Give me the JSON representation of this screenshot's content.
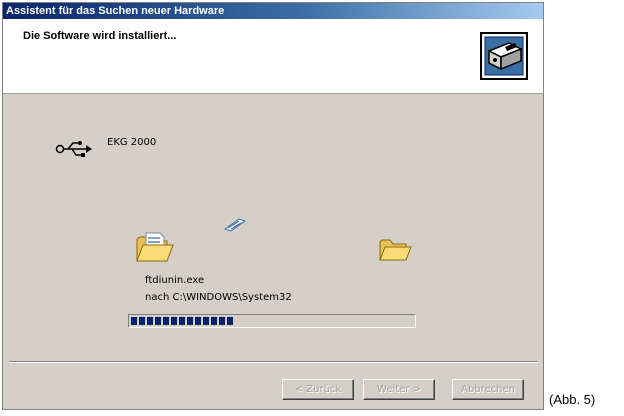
{
  "window": {
    "title": "Assistent für das Suchen neuer Hardware"
  },
  "header": {
    "title": "Die Software wird installiert...",
    "icon": "hardware-wizard-icon"
  },
  "device": {
    "icon": "usb-icon",
    "name": "EKG 2000"
  },
  "copy_animation": {
    "source_icon": "folder-open-icon",
    "flying_icon": "flying-document-icon",
    "target_icon": "folder-open-icon"
  },
  "file": {
    "name": "ftdiunin.exe",
    "destination": "nach C:\\WINDOWS\\System32"
  },
  "progress": {
    "percent": 37
  },
  "buttons": {
    "back_label": "< Zurück",
    "next_label": "Weiter >",
    "cancel_label": "Abbrechen"
  },
  "caption": "(Abb. 5)",
  "colors": {
    "titlebar_start": "#0a246a",
    "titlebar_end": "#a6caf0",
    "dialog_bg": "#d4d0c8",
    "progress_fill": "#0a246a"
  }
}
